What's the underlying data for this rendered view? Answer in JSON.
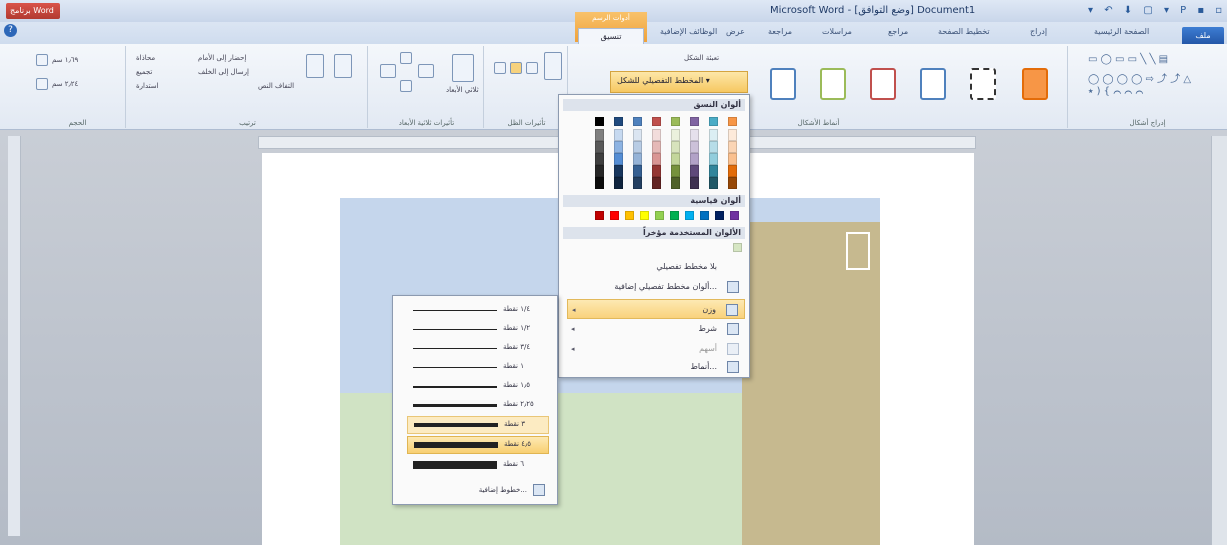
{
  "window": {
    "title": "Microsoft Word - [وضع التوافق] Document1",
    "file_button_old": "برنامج Word"
  },
  "quick_access": {
    "glyphs": "▾ ↶ ⬇ ▢ ▾ P ▪ ▫"
  },
  "help_icon": "?",
  "tabs": {
    "file": "ملف",
    "items": [
      "الصفحة الرئيسية",
      "إدراج",
      "تخطيط الصفحة",
      "مراجع",
      "مراسلات",
      "مراجعة",
      "عرض",
      "الوظائف الإضافية"
    ],
    "active": "تنسيق",
    "context_group": "أدوات الرسم"
  },
  "ribbon": {
    "groups": [
      {
        "label": "الحجم"
      },
      {
        "label": "ترتيب"
      },
      {
        "label": "تأثيرات ثلاثية الأبعاد"
      },
      {
        "label": "تأثيرات الظل"
      },
      {
        "label": "أنماط الأشكال"
      },
      {
        "label": "إدراج أشكال"
      }
    ],
    "size_values": [
      "١٫٦٩ سم",
      "٢٫٢٤ سم"
    ],
    "arrange_items": [
      "إحضار إلى الأمام",
      "إرسال إلى الخلف",
      "محاذاة",
      "تجميع",
      "استدارة",
      "التفاف النص"
    ],
    "shape_fill": "تعبئة الشكل",
    "shape_outline": "تغيير الشكل",
    "outline_button": "المخطط التفصيلي للشكل",
    "shadow_label": "تأثيرات الظل",
    "threed_label": "ثلاثي الأبعاد"
  },
  "color_menu": {
    "theme_colors_header": "ألوان النسق",
    "standard_colors_header": "ألوان قياسية",
    "recent_colors_header": "الألوان المستخدمة مؤخراً",
    "items": [
      {
        "label": "بلا مخطط تفصيلي",
        "arrow": ""
      },
      {
        "label": "ألوان مخطط تفصيلي إضافية...",
        "arrow": ""
      },
      {
        "label": "وزن",
        "arrow": "◂"
      },
      {
        "label": "شرط",
        "arrow": "◂"
      },
      {
        "label": "أسهم",
        "arrow": "◂"
      },
      {
        "label": "أنماط...",
        "arrow": ""
      }
    ],
    "standard_colors": [
      "#c00000",
      "#ff0000",
      "#ffc000",
      "#ffff00",
      "#92d050",
      "#00b050",
      "#00b0f0",
      "#0070c0",
      "#002060",
      "#7030a0"
    ],
    "theme_columns": [
      [
        "#000000",
        "#7f7f7f",
        "#595959",
        "#3f3f3f",
        "#262626",
        "#0c0c0c"
      ],
      [
        "#1f497d",
        "#c6d9f0",
        "#8db3e2",
        "#548dd4",
        "#17365d",
        "#0f243e"
      ],
      [
        "#4f81bd",
        "#dbe5f1",
        "#b8cce4",
        "#95b3d7",
        "#366092",
        "#244061"
      ],
      [
        "#c0504d",
        "#f2dcdb",
        "#e5b9b7",
        "#d99694",
        "#953734",
        "#632423"
      ],
      [
        "#9bbb59",
        "#ebf1dd",
        "#d7e3bc",
        "#c3d69b",
        "#76923c",
        "#4f6128"
      ],
      [
        "#8064a2",
        "#e5e0ec",
        "#ccc1d9",
        "#b2a2c7",
        "#5f497a",
        "#3f3151"
      ],
      [
        "#4bacc6",
        "#dbeef3",
        "#b7dde8",
        "#92cddc",
        "#31859b",
        "#205867"
      ],
      [
        "#f79646",
        "#fdeada",
        "#fbd5b5",
        "#fac08f",
        "#e36c09",
        "#974806"
      ]
    ]
  },
  "weight_menu": {
    "items": [
      {
        "label": "١/٤ نقطة"
      },
      {
        "label": "١/٢ نقطة"
      },
      {
        "label": "٣/٤ نقطة"
      },
      {
        "label": "١ نقطة"
      },
      {
        "label": "١٫٥ نقطة"
      },
      {
        "label": "٢٫٢٥ نقطة"
      },
      {
        "label": "٣ نقطة"
      },
      {
        "label": "٤٫٥ نقطة"
      },
      {
        "label": "٦ نقطة"
      }
    ],
    "more_label": "خطوط إضافية..."
  },
  "colors": {
    "accent_orange": "#f0a23a",
    "doc_blue": "#c5d6ec",
    "doc_green": "#d0e3c4",
    "doc_tan": "#c6b98f",
    "highlight": "#f9d27c"
  }
}
